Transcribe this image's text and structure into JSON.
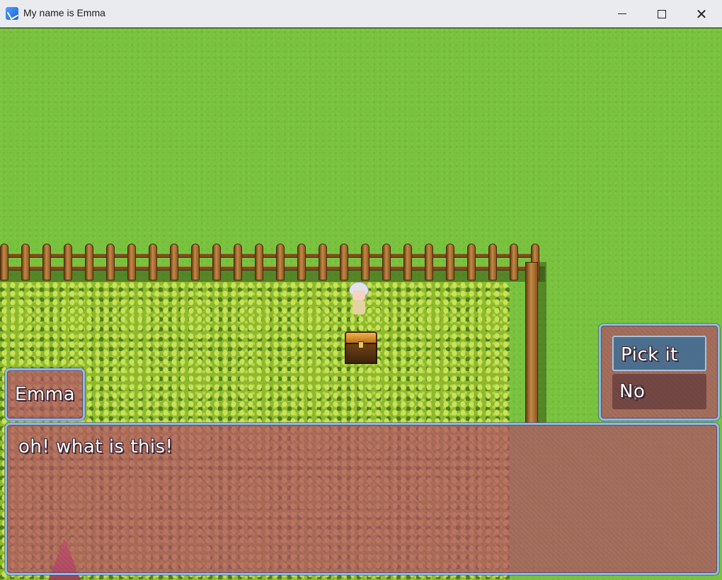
{
  "window": {
    "title": "My name is Emma",
    "minimize_symbol": "",
    "maximize_symbol": "",
    "close_symbol": "✕"
  },
  "dialog": {
    "speaker": "Emma",
    "message": "oh! what is this!"
  },
  "choices": [
    {
      "label": "Pick it up",
      "selected": true
    },
    {
      "label": "No",
      "selected": false
    }
  ],
  "colors": {
    "grass": "#78c23d",
    "window_bg": "#b04862",
    "window_border": "#8fb7e8",
    "selected_choice": "#3c6e96"
  },
  "icons": {
    "app": "game-app-icon",
    "minimize": "minimize-icon",
    "maximize": "maximize-icon",
    "close": "close-icon"
  }
}
